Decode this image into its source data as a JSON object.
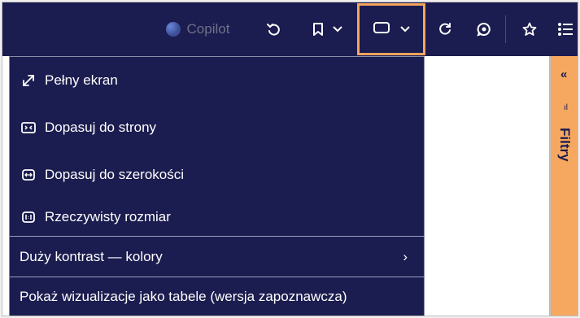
{
  "toolbar": {
    "copilot_label": "Copilot",
    "icons": [
      "copilot-icon",
      "undo-icon",
      "bookmark-icon",
      "chevron-down-icon",
      "view-icon",
      "refresh-icon",
      "comment-icon",
      "star-icon",
      "list-icon"
    ]
  },
  "view_menu": {
    "items": [
      {
        "label": "Pełny ekran",
        "icon": "fullscreen-icon"
      },
      {
        "label": "Dopasuj do strony",
        "icon": "fit-to-page-icon"
      },
      {
        "label": "Dopasuj do szerokości",
        "icon": "fit-to-width-icon"
      },
      {
        "label": "Rzeczywisty rozmiar",
        "icon": "actual-size-icon"
      }
    ],
    "contrast_label": "Duży kontrast — kolory",
    "tables_label": "Pokaż wizualizacje jako tabele (wersja zapoznawcza)"
  },
  "filters_pane": {
    "label": "Filtry"
  },
  "colors": {
    "toolbar_bg": "#1b1c4f",
    "highlight": "#f4a460",
    "filters_bg": "#f6a860"
  }
}
